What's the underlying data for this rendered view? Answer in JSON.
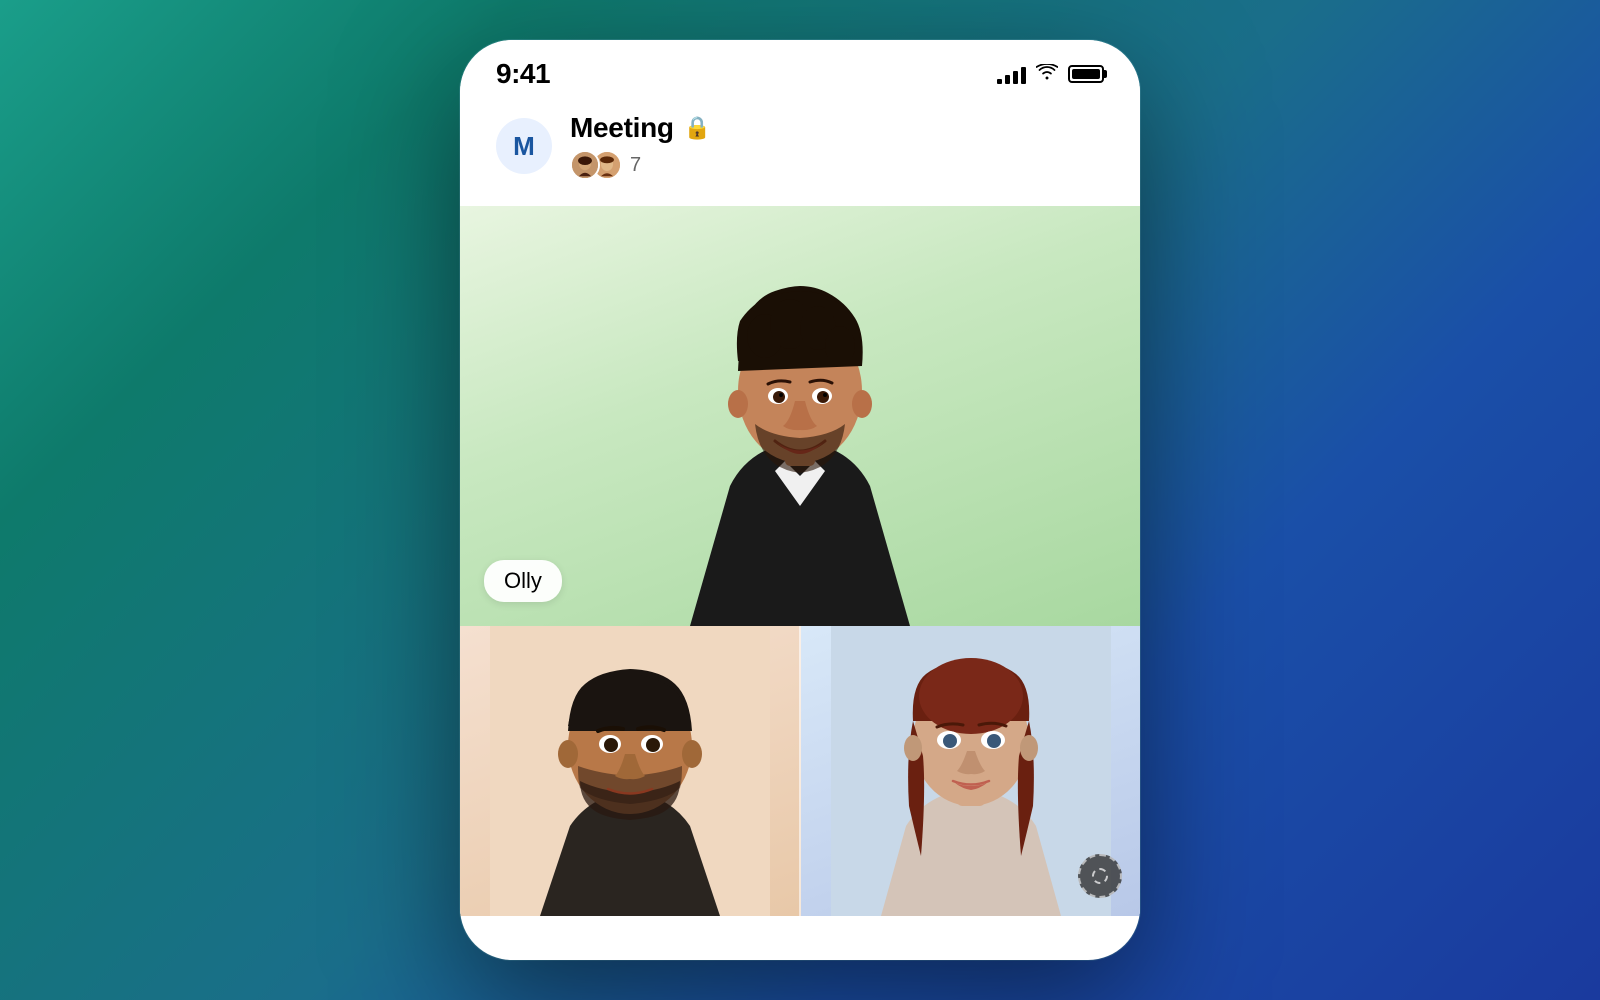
{
  "statusBar": {
    "time": "9:41",
    "signalBars": [
      4,
      8,
      12,
      16
    ],
    "batteryLabel": "battery"
  },
  "header": {
    "avatarLetter": "M",
    "meetingTitle": "Meeting",
    "lockEmoji": "🔒",
    "participantCount": "7"
  },
  "mainVideo": {
    "participantName": "Olly",
    "backgroundColor": "#d8efd0"
  },
  "bottomVideos": [
    {
      "id": "video-left",
      "hasCamera": true
    },
    {
      "id": "video-right",
      "hasCamera": false
    }
  ]
}
